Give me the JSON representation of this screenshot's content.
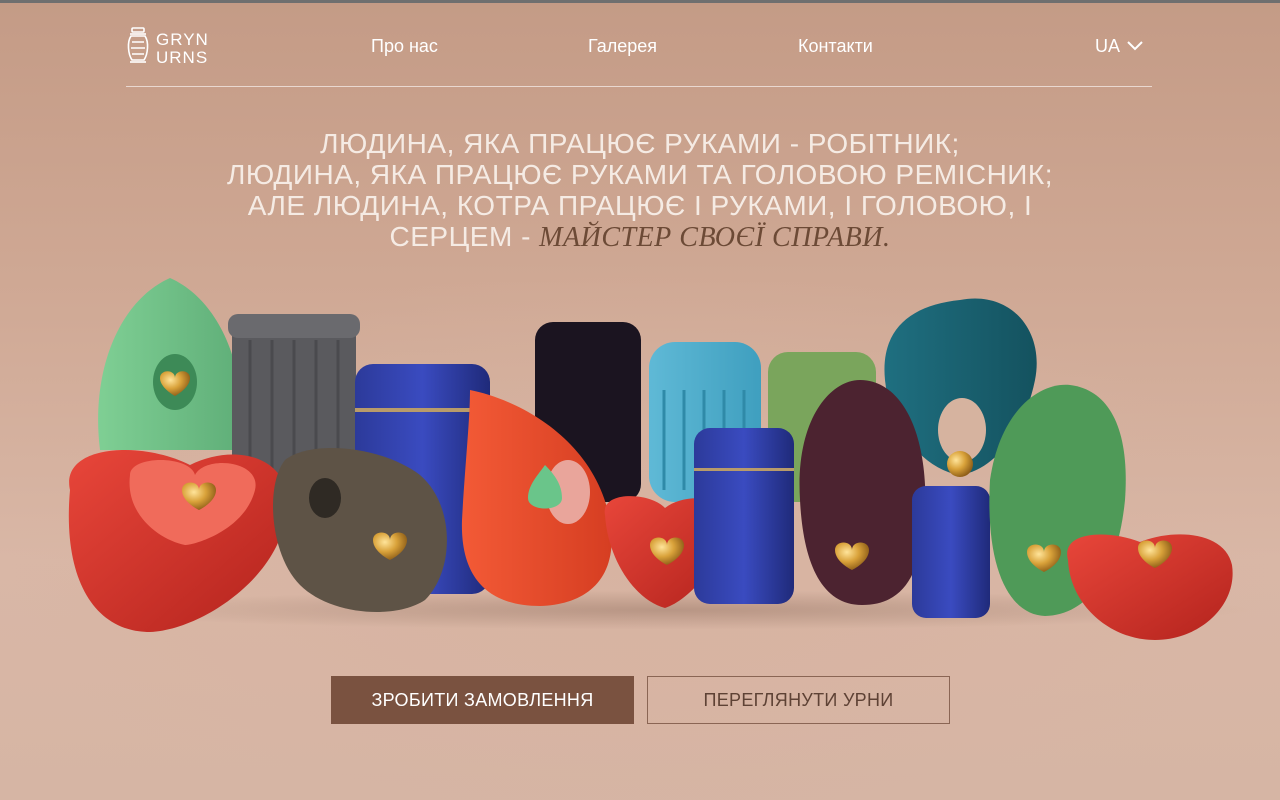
{
  "logo": {
    "line1": "GRYN",
    "line2": "URNS"
  },
  "nav": {
    "about": "Про нас",
    "gallery": "Галерея",
    "contacts": "Контакти"
  },
  "language": {
    "selected": "UA"
  },
  "quote": {
    "line1": "ЛЮДИНА, ЯКА ПРАЦЮЄ РУКАМИ - РОБІТНИК;",
    "line2": "ЛЮДИНА, ЯКА ПРАЦЮЄ РУКАМИ ТА ГОЛОВОЮ РЕМІСНИК;",
    "line3": "АЛЕ ЛЮДИНА, КОТРА ПРАЦЮЄ І РУКАМИ, І ГОЛОВОЮ, І",
    "line4_prefix": "СЕРЦЕМ - ",
    "line4_accent": "МАЙСТЕР СВОЄЇ СПРАВИ."
  },
  "buttons": {
    "order": "ЗРОБИТИ ЗАМОВЛЕННЯ",
    "view_urns": "ПЕРЕГЛЯНУТИ УРНИ"
  },
  "colors": {
    "primary_button": "#7a5240",
    "accent_text": "#6c4a36",
    "background": "#cfa894"
  },
  "icons": {
    "logo": "urn-icon",
    "language_dropdown": "chevron-down-icon"
  }
}
